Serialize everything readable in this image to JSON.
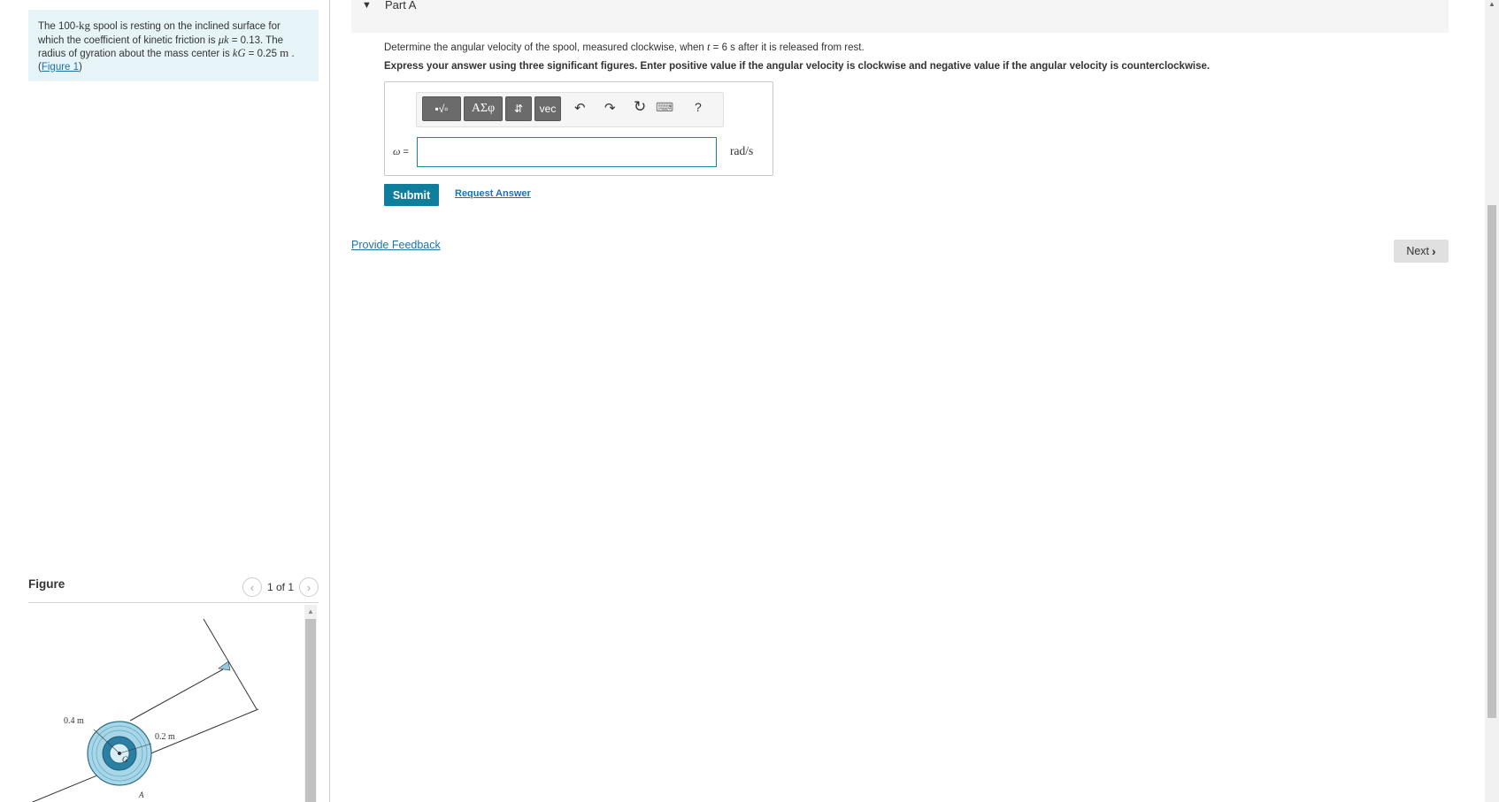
{
  "problem": {
    "text_1": "The 100-",
    "mass_unit": "kg",
    "text_2": " spool is resting on the inclined surface for which the coefficient of kinetic friction is ",
    "mu_symbol": "μk",
    "text_3": " = 0.13. The radius of gyration about the mass center is ",
    "k_symbol": "kG",
    "text_4": " = 0.25 ",
    "length_unit": "m",
    "text_5": " .",
    "figure_link_open": "(",
    "figure_link": "Figure 1",
    "figure_link_close": ")"
  },
  "figure": {
    "title": "Figure",
    "pager_text": "1 of 1",
    "label_outer": "0.4 m",
    "label_inner": "0.2 m",
    "label_g": "G",
    "label_a": "A"
  },
  "part": {
    "title": "Part A",
    "question_1": "Determine the angular velocity of the spool, measured clockwise, when ",
    "t_symbol": "t",
    "question_2": " = 6  s after it is released from rest.",
    "instruction": "Express your answer using three significant figures. Enter positive value if the angular velocity is clockwise and negative value if the angular velocity is counterclockwise."
  },
  "toolbar": {
    "templates_label": "▪√▫",
    "greek_label": "ΑΣφ",
    "arrows_label": "⇵",
    "vec_label": "vec",
    "undo_icon": "↶",
    "redo_icon": "↷",
    "reset_icon": "↻",
    "keyboard_icon": "⌨",
    "help_label": "?"
  },
  "answer": {
    "symbol": "ω",
    "equals": " =",
    "value": "",
    "unit": "rad/s"
  },
  "actions": {
    "submit_label": "Submit",
    "request_answer_label": "Request Answer",
    "feedback_label": "Provide Feedback",
    "next_label": "Next"
  },
  "colors": {
    "accent": "#0f7d9c",
    "link": "#1a74a8",
    "problem_bg": "#e6f4f8"
  }
}
